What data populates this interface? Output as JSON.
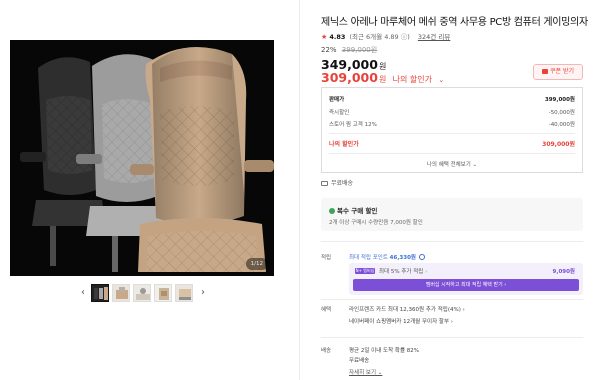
{
  "gallery": {
    "counter": "1/12",
    "prev_arrow": "‹",
    "next_arrow": "›",
    "thumbs": [
      "chair-main",
      "chair-lifestyle-1",
      "chair-lifestyle-2",
      "chair-detail-1",
      "chair-detail-2"
    ],
    "colors": {
      "black": "#3a3a3a",
      "gray": "#a9a9a9",
      "beige": "#c8a989",
      "background": "#070707"
    }
  },
  "product": {
    "title": "제닉스 아레나 마루체어 메쉬 중역 사무용 PC방 컴퓨터 게이밍의자",
    "rating": {
      "star": "★",
      "score": "4.83",
      "summary": "(최근 6개월 4.89 ⓘ)",
      "reviews": "324건 리뷰"
    }
  },
  "price": {
    "discount_pct": "22%",
    "original": "399,000원",
    "sale": "349,000",
    "my_price": "309,000",
    "won": "원",
    "my_price_label": "나의 할인가",
    "chevron": "⌄",
    "coupon_label": "쿠폰 받기",
    "accent": "#e8423a"
  },
  "breakdown": {
    "rows": [
      {
        "label": "판매가",
        "value": "399,000원"
      },
      {
        "label": "즉시할인",
        "value": "-50,000원"
      },
      {
        "label": "스토어 찜 고객 12%",
        "value": "-40,000원"
      }
    ],
    "total": {
      "label": "나의 할인가",
      "value": "309,000원"
    },
    "view_all": "나의 혜택 전체보기 ⌄"
  },
  "shipping_note": "무료배송",
  "multi_discount": {
    "title": "복수 구매 할인",
    "desc": "2개 이상 구매시 수량만큼 7,000원 할인"
  },
  "points": {
    "section_label": "적립",
    "max_label": "최대 적립 포인트",
    "max_value": "46,330원",
    "badge": "N+ 멤버십",
    "extra_label": "최대 5% 추가 적립",
    "extra_chevron": "›",
    "extra_amount": "9,090원",
    "cta": "멤버십 시작하고 최대 적립 혜택 받기 ›",
    "color": "#7b4fd6"
  },
  "benefits": {
    "section_label": "혜택",
    "line1": "라인프렌즈 카드 최대 12,360원 추가 적립(4%) ›",
    "line2": "네이버페이 쇼핑멤버카 12개월 무이자 할부 ›"
  },
  "delivery": {
    "section_label": "배송",
    "line1": "평균 2일 이내 도착 확률 82%",
    "line2": "무료배송",
    "link": "자세히 보기 ⌄"
  }
}
